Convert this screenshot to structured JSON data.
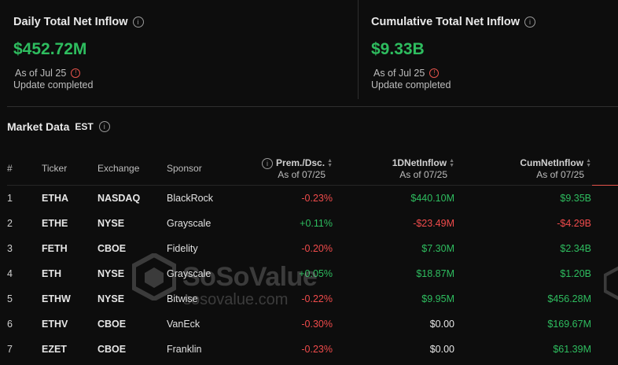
{
  "daily": {
    "title": "Daily Total Net Inflow",
    "value": "$452.72M",
    "as_of": "As of Jul 25",
    "status": "Update completed"
  },
  "cumulative": {
    "title": "Cumulative Total Net Inflow",
    "value": "$9.33B",
    "as_of": "As of Jul 25",
    "status": "Update completed"
  },
  "market": {
    "title": "Market Data",
    "timezone": "EST"
  },
  "columns": {
    "index": "#",
    "ticker": "Ticker",
    "exchange": "Exchange",
    "sponsor": "Sponsor",
    "prem": "Prem./Dsc.",
    "prem_sub": "As of 07/25",
    "d1": "1DNetInflow",
    "d1_sub": "As of 07/25",
    "cum": "CumNetInflow",
    "cum_sub": "As of 07/25"
  },
  "rows": [
    {
      "idx": "1",
      "ticker": "ETHA",
      "exchange": "NASDAQ",
      "sponsor": "BlackRock",
      "prem": "-0.23%",
      "d1": "$440.10M",
      "cum": "$9.35B"
    },
    {
      "idx": "2",
      "ticker": "ETHE",
      "exchange": "NYSE",
      "sponsor": "Grayscale",
      "prem": "+0.11%",
      "d1": "-$23.49M",
      "cum": "-$4.29B"
    },
    {
      "idx": "3",
      "ticker": "FETH",
      "exchange": "CBOE",
      "sponsor": "Fidelity",
      "prem": "-0.20%",
      "d1": "$7.30M",
      "cum": "$2.34B"
    },
    {
      "idx": "4",
      "ticker": "ETH",
      "exchange": "NYSE",
      "sponsor": "Grayscale",
      "prem": "+0.05%",
      "d1": "$18.87M",
      "cum": "$1.20B"
    },
    {
      "idx": "5",
      "ticker": "ETHW",
      "exchange": "NYSE",
      "sponsor": "Bitwise",
      "prem": "-0.22%",
      "d1": "$9.95M",
      "cum": "$456.28M"
    },
    {
      "idx": "6",
      "ticker": "ETHV",
      "exchange": "CBOE",
      "sponsor": "VanEck",
      "prem": "-0.30%",
      "d1": "$0.00",
      "cum": "$169.67M"
    },
    {
      "idx": "7",
      "ticker": "EZET",
      "exchange": "CBOE",
      "sponsor": "Franklin",
      "prem": "-0.23%",
      "d1": "$0.00",
      "cum": "$61.39M"
    }
  ],
  "watermark": {
    "brand": "SoSoValue",
    "site": "sosovalue.com"
  },
  "colors": {
    "positive": "#2ebd5f",
    "negative": "#f04b4b",
    "background": "#0d0d0d"
  }
}
